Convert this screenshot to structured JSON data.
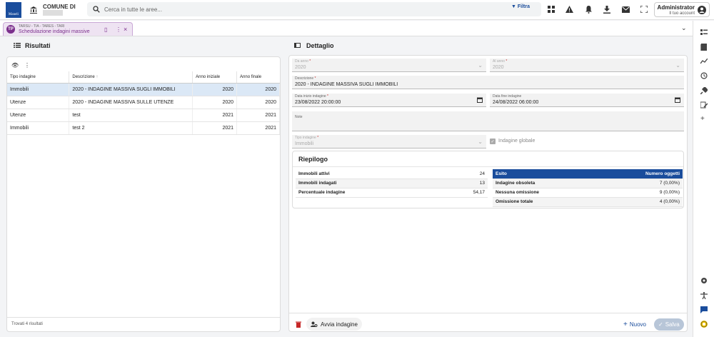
{
  "header": {
    "logo_text": "Maneli",
    "comune_label": "COMUNE DI",
    "search_placeholder": "Cerca in tutte le aree...",
    "filter_label": "Filtra",
    "user_name": "Administrator",
    "user_sub": "Il tuo account"
  },
  "tab": {
    "category": "TARSU - TIA - TARES - TARI",
    "title": "Schedulazione indagini massive",
    "badge": "TP"
  },
  "risultati": {
    "title": "Risultati",
    "columns": [
      "Tipo indagine",
      "Descrizione",
      "Anno iniziale",
      "Anno finale"
    ],
    "sort_indicator": "↑",
    "rows": [
      [
        "Immobili",
        "2020 - INDAGINE MASSIVA SUGLI IMMOBILI",
        "2020",
        "2020"
      ],
      [
        "Utenze",
        "2020 - INDAGINE MASSIVA SULLE UTENZE",
        "2020",
        "2020"
      ],
      [
        "Utenze",
        "test",
        "2021",
        "2021"
      ],
      [
        "Immobili",
        "test 2",
        "2021",
        "2021"
      ]
    ],
    "footer": "Trovati 4 risultati"
  },
  "dettaglio": {
    "title": "Dettaglio",
    "da_anno_label": "Da anno",
    "da_anno": "2020",
    "al_anno_label": "Al anno",
    "al_anno": "2020",
    "descrizione_label": "Descrizione",
    "descrizione": "2020 - INDAGINE MASSIVA SUGLI IMMOBILI",
    "data_inizio_label": "Data inizio indagine",
    "data_inizio": "23/08/2022 20:00:00",
    "data_fine_label": "Data fine indagine",
    "data_fine": "24/08/2022 06:00:00",
    "note_label": "Note",
    "tipo_label": "Tipo indagine",
    "tipo": "Immobili",
    "globale_label": "Indagine globale"
  },
  "riepilogo": {
    "title": "Riepilogo",
    "left": [
      [
        "Immobili attivi",
        "24"
      ],
      [
        "Immobili indagati",
        "13"
      ],
      [
        "Percentuale indagine",
        "54,17"
      ]
    ],
    "right_headers": [
      "Esito",
      "Numero oggetti"
    ],
    "right": [
      [
        "Indagine obsoleta",
        "7 (0,00%)"
      ],
      [
        "Nessuna omissione",
        "9 (0,00%)"
      ],
      [
        "Omissione totale",
        "4 (0,00%)"
      ]
    ]
  },
  "footer": {
    "avvia": "Avvia indagine",
    "nuovo": "Nuovo",
    "salva": "Salva"
  },
  "colors": {
    "accent": "#1a4d9c",
    "tab": "#7b2f8c",
    "danger": "#c62828"
  }
}
